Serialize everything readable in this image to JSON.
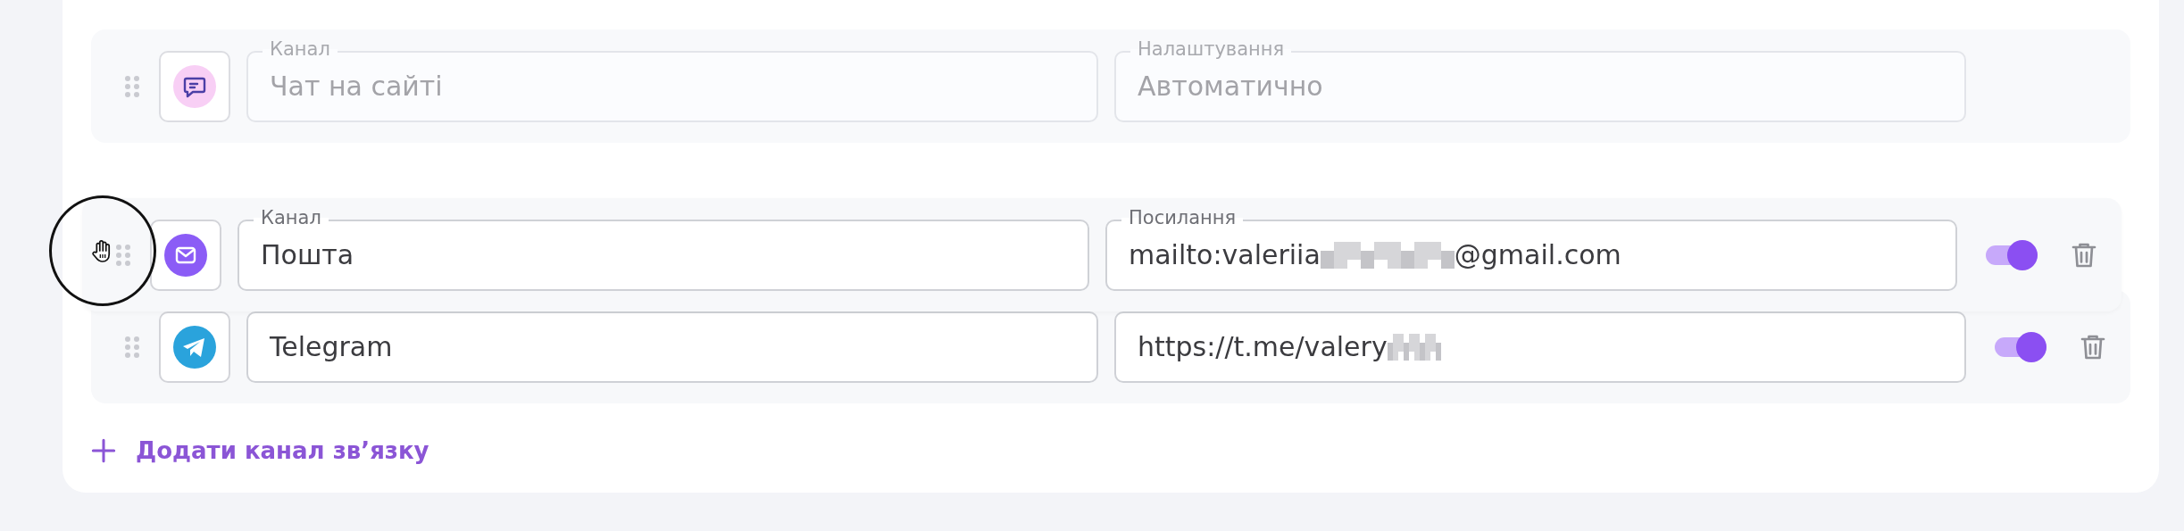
{
  "channels": [
    {
      "kind": "builtin",
      "disabled": true,
      "dragging": false,
      "color": "#f8cff5",
      "fields": [
        {
          "label": "Канал",
          "value": "Чат на сайті"
        },
        {
          "label": "Налаштування",
          "value": "Автоматично"
        }
      ]
    },
    {
      "kind": "custom",
      "disabled": false,
      "dragging": true,
      "color": "#8b5cf6",
      "on": true,
      "fields": [
        {
          "label": "Канал",
          "value": "Пошта"
        },
        {
          "label": "Посилання",
          "value": "mailto:valeriia",
          "redacted": true,
          "value_suffix": "@gmail.com"
        }
      ]
    },
    {
      "kind": "custom",
      "disabled": false,
      "dragging": false,
      "color": "#2aa3dc",
      "on": true,
      "fields": [
        {
          "value": "Telegram"
        },
        {
          "value": "https://t.me/valery",
          "redacted": true
        }
      ]
    }
  ],
  "add_button": {
    "label": "Додати канал зв’язку"
  }
}
